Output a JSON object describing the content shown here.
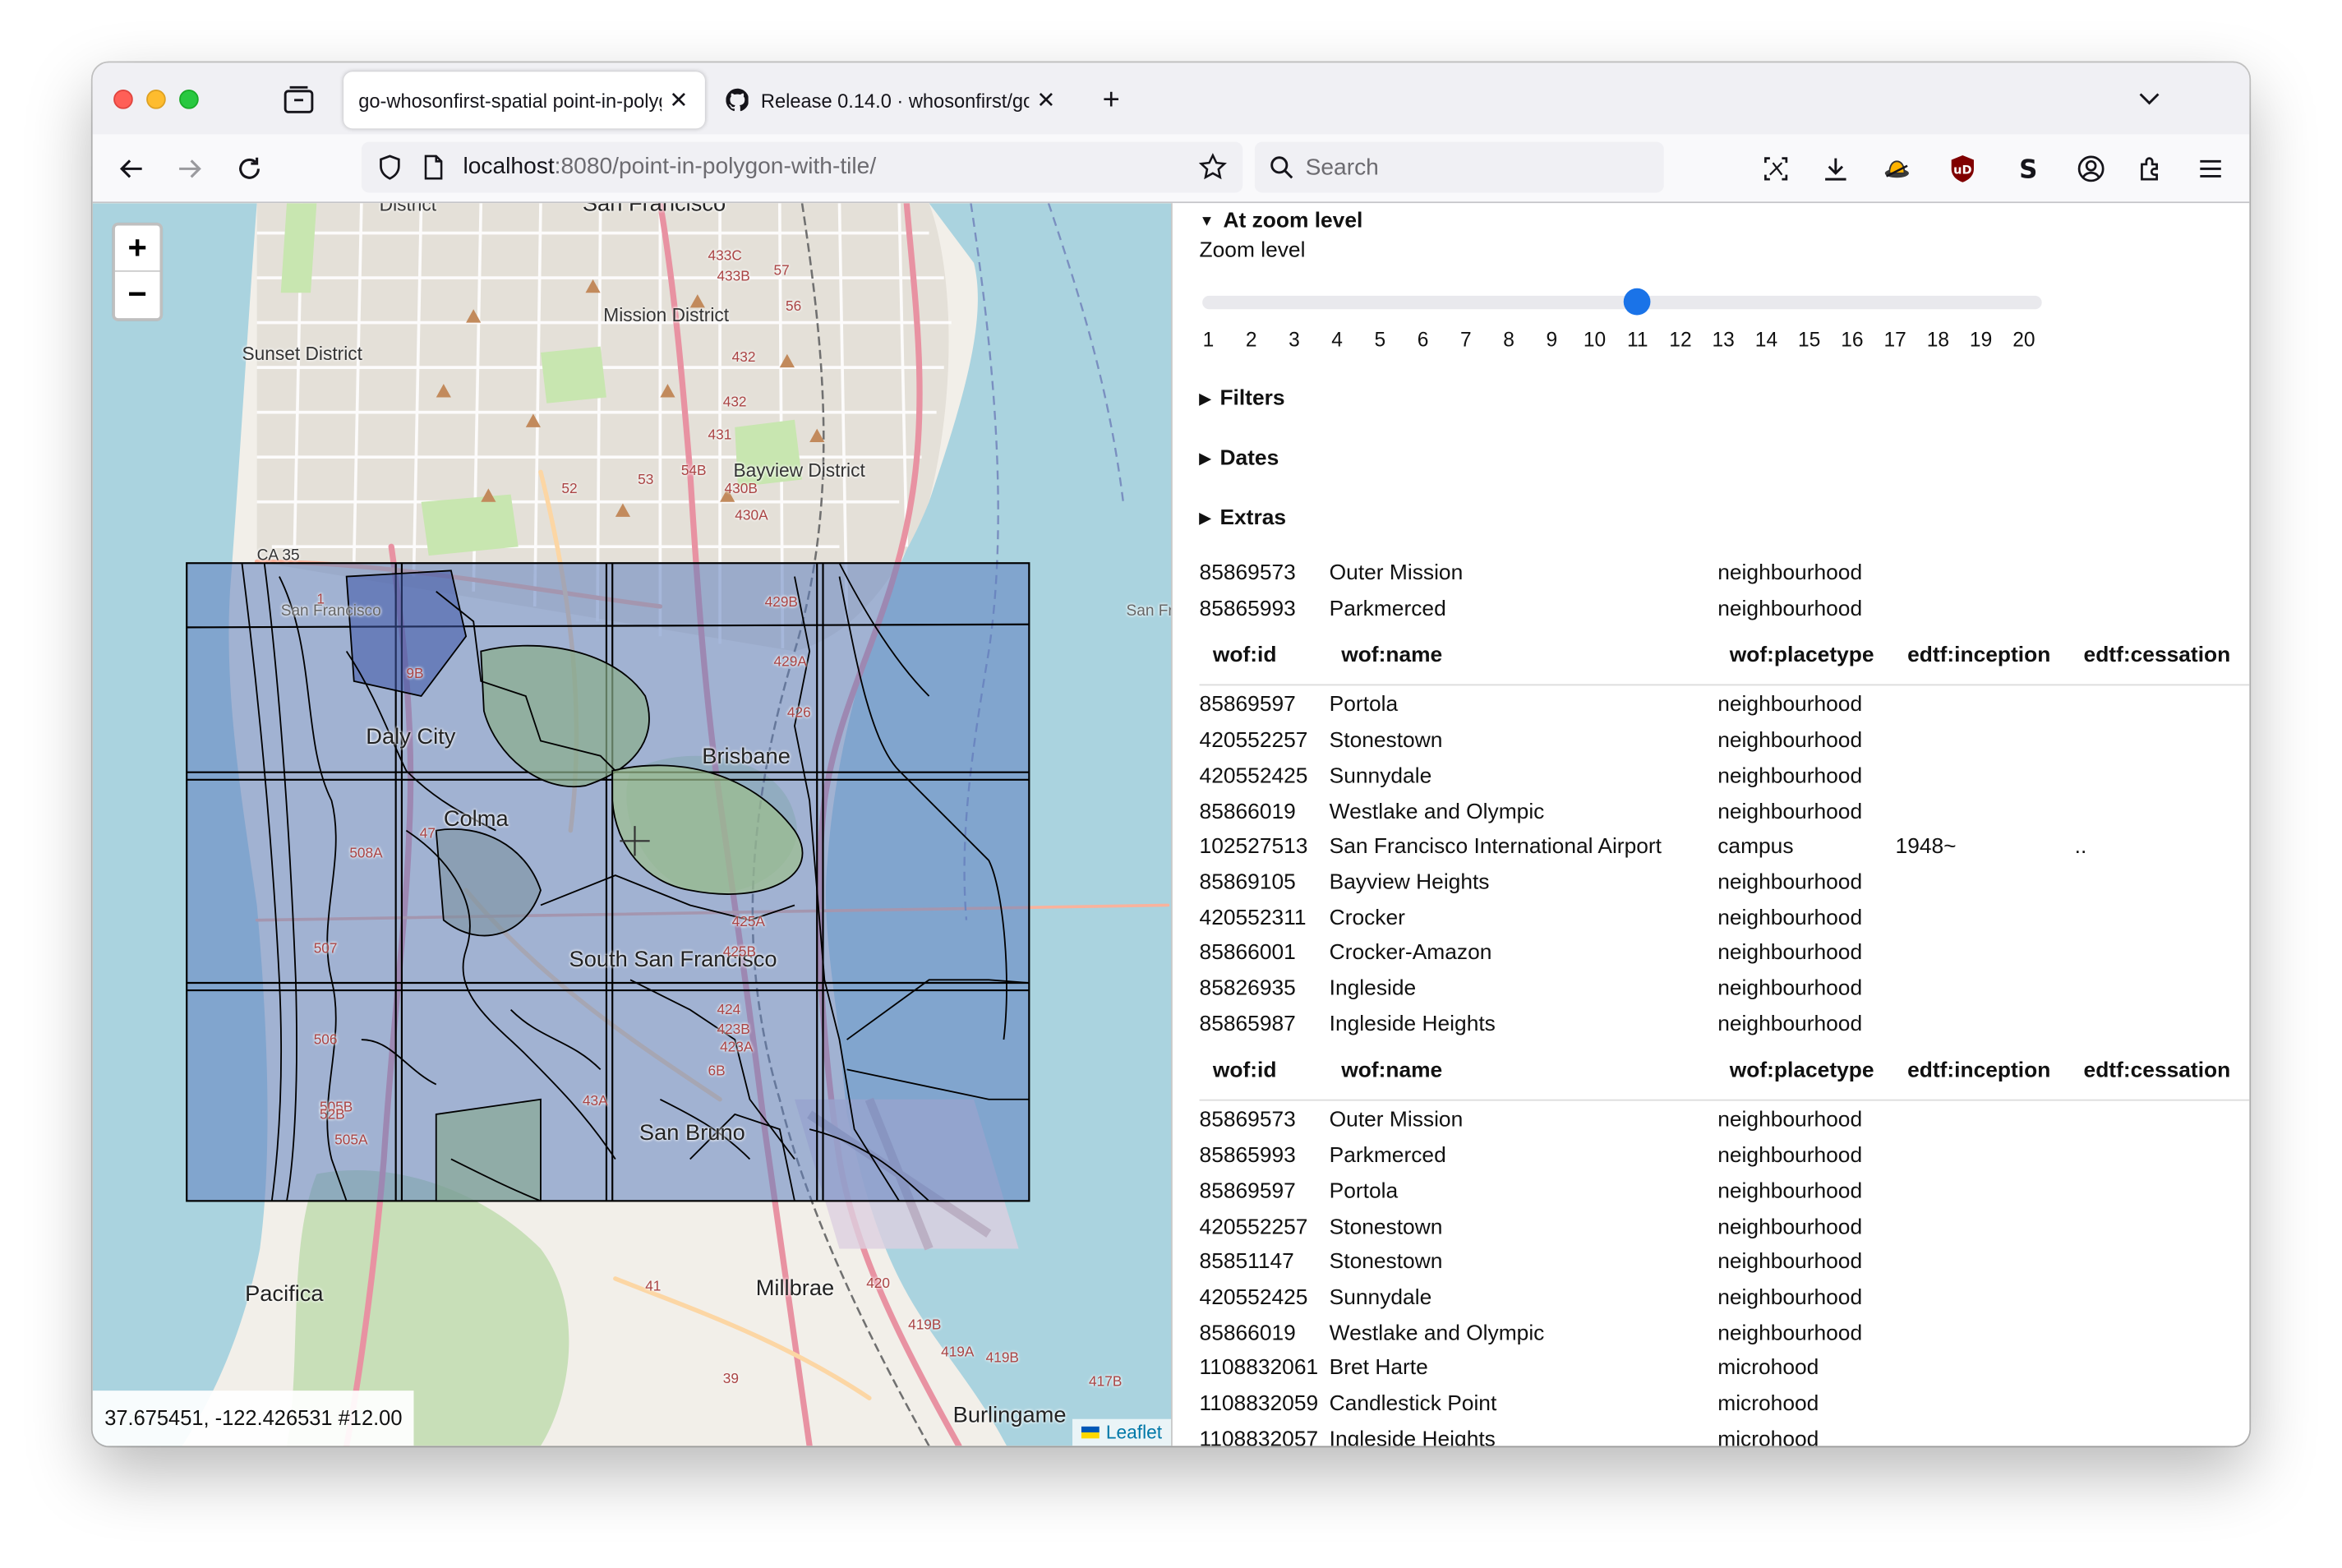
{
  "browser": {
    "tabs": [
      {
        "title": "go-whosonfirst-spatial point-in-polygon-with-tile/",
        "active": true
      },
      {
        "title": "Release 0.14.0 · whosonfirst/go-whosonfirst",
        "active": false
      }
    ],
    "url_host": "localhost",
    "url_rest": ":8080/point-in-polygon-with-tile/",
    "search_placeholder": "Search"
  },
  "map": {
    "zoom_in": "+",
    "zoom_out": "−",
    "coords": "37.675451, -122.426531 #12.00",
    "attribution": "Leaflet",
    "labels": {
      "district": "District",
      "san_francisco_top": "San Francisco",
      "mission_district": "Mission District",
      "sunset_district": "Sunset District",
      "bayview_district": "Bayview District",
      "ca35": "CA 35",
      "san_francisco_small": "San Francisco",
      "san_fr": "San Fr",
      "daly_city": "Daly City",
      "brisbane": "Brisbane",
      "colma": "Colma",
      "south_sf": "South San Francisco",
      "san_bruno": "San Bruno",
      "pacifica": "Pacifica",
      "millbrae": "Millbrae",
      "burlingame": "Burlingame"
    },
    "route_numbers": [
      "433C",
      "433B",
      "57",
      "56",
      "432",
      "432",
      "431",
      "54B",
      "430B",
      "430A",
      "53",
      "52",
      "429B",
      "429A",
      "426",
      "425B",
      "425A",
      "424",
      "423B",
      "423A",
      "508A",
      "507",
      "506",
      "505B",
      "505A",
      "41",
      "420",
      "419B",
      "419A",
      "419B",
      "417B",
      "39",
      "9B",
      "47",
      "6B",
      "43A",
      "52B",
      "1"
    ]
  },
  "panel": {
    "zoom_section": "At zoom level",
    "zoom_label": "Zoom level",
    "zoom_value": 11,
    "zoom_ticks": [
      "1",
      "2",
      "3",
      "4",
      "5",
      "6",
      "7",
      "8",
      "9",
      "10",
      "11",
      "12",
      "13",
      "14",
      "15",
      "16",
      "17",
      "18",
      "19",
      "20"
    ],
    "filters": "Filters",
    "dates": "Dates",
    "extras": "Extras",
    "headers": [
      "wof:id",
      "wof:name",
      "wof:placetype",
      "edtf:inception",
      "edtf:cessation"
    ],
    "group1": [
      {
        "id": "85869573",
        "name": "Outer Mission",
        "placetype": "neighbourhood",
        "inception": "",
        "cessation": ""
      },
      {
        "id": "85865993",
        "name": "Parkmerced",
        "placetype": "neighbourhood",
        "inception": "",
        "cessation": ""
      }
    ],
    "group2": [
      {
        "id": "85869597",
        "name": "Portola",
        "placetype": "neighbourhood",
        "inception": "",
        "cessation": ""
      },
      {
        "id": "420552257",
        "name": "Stonestown",
        "placetype": "neighbourhood",
        "inception": "",
        "cessation": ""
      },
      {
        "id": "420552425",
        "name": "Sunnydale",
        "placetype": "neighbourhood",
        "inception": "",
        "cessation": ""
      },
      {
        "id": "85866019",
        "name": "Westlake and Olympic",
        "placetype": "neighbourhood",
        "inception": "",
        "cessation": ""
      },
      {
        "id": "102527513",
        "name": "San Francisco International Airport",
        "placetype": "campus",
        "inception": "1948~",
        "cessation": ".."
      },
      {
        "id": "85869105",
        "name": "Bayview Heights",
        "placetype": "neighbourhood",
        "inception": "",
        "cessation": ""
      },
      {
        "id": "420552311",
        "name": "Crocker",
        "placetype": "neighbourhood",
        "inception": "",
        "cessation": ""
      },
      {
        "id": "85866001",
        "name": "Crocker-Amazon",
        "placetype": "neighbourhood",
        "inception": "",
        "cessation": ""
      },
      {
        "id": "85826935",
        "name": "Ingleside",
        "placetype": "neighbourhood",
        "inception": "",
        "cessation": ""
      },
      {
        "id": "85865987",
        "name": "Ingleside Heights",
        "placetype": "neighbourhood",
        "inception": "",
        "cessation": ""
      }
    ],
    "group3": [
      {
        "id": "85869573",
        "name": "Outer Mission",
        "placetype": "neighbourhood",
        "inception": "",
        "cessation": ""
      },
      {
        "id": "85865993",
        "name": "Parkmerced",
        "placetype": "neighbourhood",
        "inception": "",
        "cessation": ""
      },
      {
        "id": "85869597",
        "name": "Portola",
        "placetype": "neighbourhood",
        "inception": "",
        "cessation": ""
      },
      {
        "id": "420552257",
        "name": "Stonestown",
        "placetype": "neighbourhood",
        "inception": "",
        "cessation": ""
      },
      {
        "id": "85851147",
        "name": "Stonestown",
        "placetype": "neighbourhood",
        "inception": "",
        "cessation": ""
      },
      {
        "id": "420552425",
        "name": "Sunnydale",
        "placetype": "neighbourhood",
        "inception": "",
        "cessation": ""
      },
      {
        "id": "85866019",
        "name": "Westlake and Olympic",
        "placetype": "neighbourhood",
        "inception": "",
        "cessation": ""
      },
      {
        "id": "1108832061",
        "name": "Bret Harte",
        "placetype": "microhood",
        "inception": "",
        "cessation": ""
      },
      {
        "id": "1108832059",
        "name": "Candlestick Point",
        "placetype": "microhood",
        "inception": "",
        "cessation": ""
      },
      {
        "id": "1108832057",
        "name": "Ingleside Heights",
        "placetype": "microhood",
        "inception": "",
        "cessation": ""
      }
    ]
  },
  "colors": {
    "water": "#aad3df",
    "land": "#f2efe9",
    "tile_fill": "#5f7fc0",
    "slider_accent": "#1a73e8"
  }
}
